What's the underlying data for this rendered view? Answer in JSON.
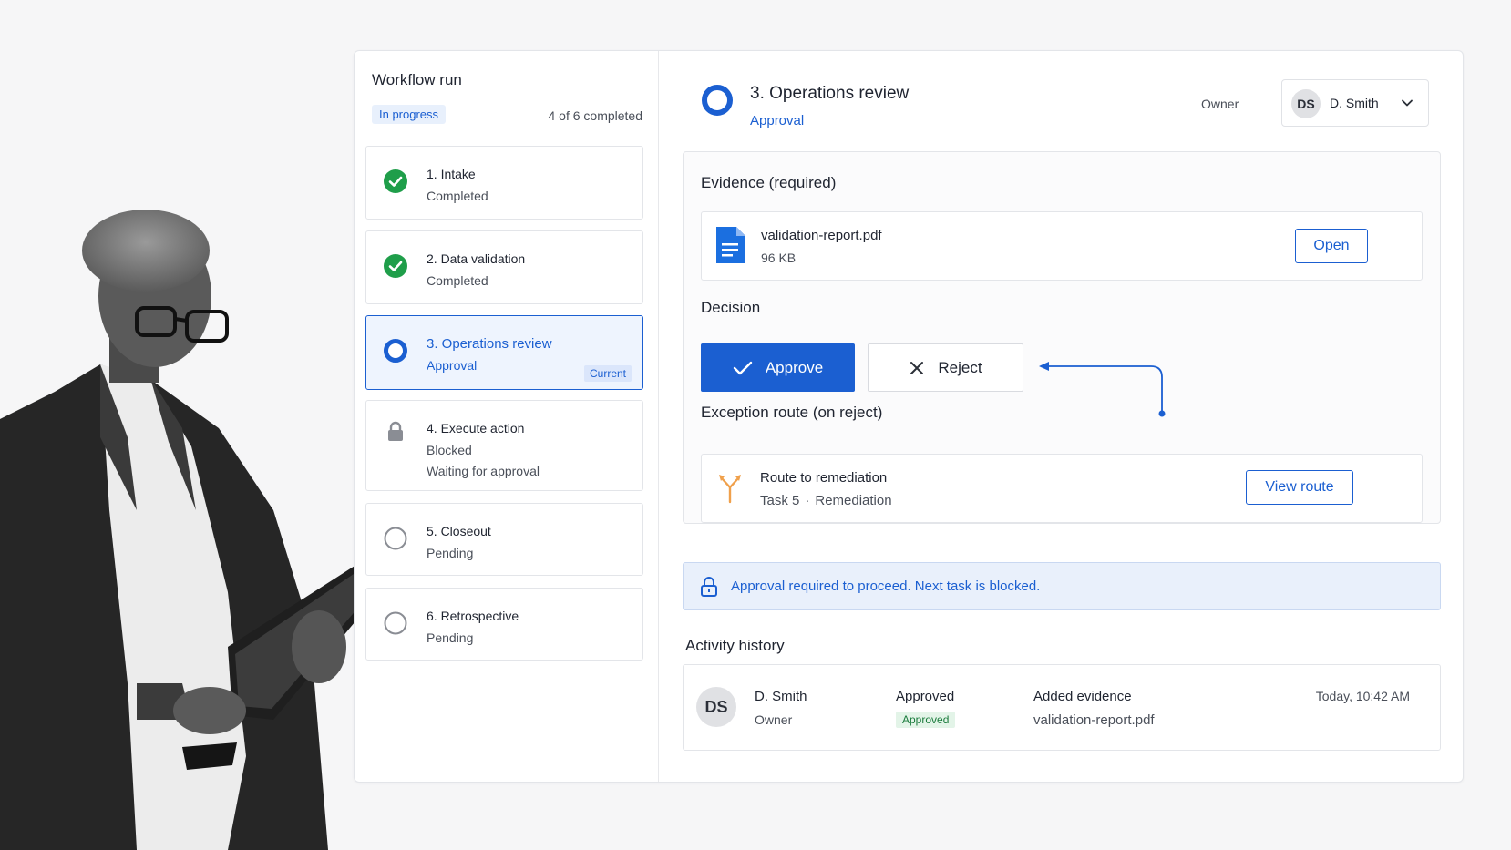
{
  "workflow": {
    "title": "Workflow run",
    "status": "In progress",
    "progress_text": "4 of 6 completed",
    "steps": [
      {
        "title": "1. Intake",
        "status": "Completed",
        "note": "",
        "state": "completed"
      },
      {
        "title": "2. Data validation",
        "status": "Completed",
        "note": "",
        "state": "completed"
      },
      {
        "title": "3. Operations review",
        "status": "Approval",
        "note": "",
        "state": "current",
        "badge": "Current"
      },
      {
        "title": "4. Execute action",
        "status": "Blocked",
        "note": "Waiting for approval",
        "state": "blocked"
      },
      {
        "title": "5. Closeout",
        "status": "Pending",
        "note": "",
        "state": "pending"
      },
      {
        "title": "6. Retrospective",
        "status": "Pending",
        "note": "",
        "state": "pending"
      }
    ]
  },
  "task": {
    "title": "3. Operations review",
    "subtitle": "Approval",
    "owner_label": "Owner",
    "owner": {
      "initials": "DS",
      "name": "D. Smith"
    }
  },
  "evidence": {
    "heading": "Evidence (required)",
    "file_name": "validation-report.pdf",
    "file_size": "96 KB",
    "open_label": "Open"
  },
  "decision": {
    "heading": "Decision",
    "approve_label": "Approve",
    "reject_label": "Reject"
  },
  "exception": {
    "heading": "Exception route (on reject)",
    "title": "Route to remediation",
    "task": "Task 5",
    "separator": "·",
    "target": "Remediation",
    "button_label": "View route"
  },
  "notice": {
    "text": "Approval required to proceed. Next task is blocked."
  },
  "activity": {
    "heading": "Activity history",
    "entries": [
      {
        "initials": "DS",
        "name": "D. Smith",
        "role": "Owner",
        "status": "Approved",
        "badge": "Approved",
        "action": "Added evidence",
        "file": "validation-report.pdf",
        "time": "Today, 10:42 AM"
      }
    ]
  },
  "colors": {
    "accent": "#1b5fd1",
    "success": "#1f9e4a",
    "route_icon": "#f0a04b",
    "notice_bg": "#e9f0fb"
  }
}
